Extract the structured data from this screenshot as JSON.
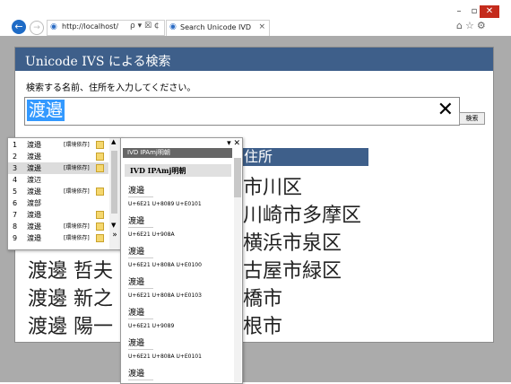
{
  "browser": {
    "url": "http://localhost/",
    "tab_title": "Search Unicode IVD",
    "search_tools": "ρ ▾ ☒ ¢",
    "win_min": "–",
    "win_max": "▫",
    "win_close": "✕",
    "back": "←",
    "forward": "→",
    "tab_close": "×",
    "icons": "⌂☆⚙"
  },
  "page": {
    "heading": "Unicode IVS による検索",
    "prompt": "検索する名前、住所を入力してください。",
    "search_value": "渡邉",
    "clear": "✕",
    "search_button": "検索",
    "address_column": "住所",
    "results": [
      {
        "name": "",
        "address": "市川区"
      },
      {
        "name": "",
        "address": "川崎市多摩区"
      },
      {
        "name": "",
        "address": "横浜市泉区"
      },
      {
        "name": "渡邊 哲夫",
        "address": "古屋市緑区"
      },
      {
        "name": "渡邊 新之",
        "address": "橋市"
      },
      {
        "name": "渡邊 陽一",
        "address": "根市"
      }
    ]
  },
  "candidates": {
    "items": [
      {
        "num": "1",
        "word": "渡邉",
        "tag": "[環境依存]"
      },
      {
        "num": "2",
        "word": "渡邊",
        "tag": ""
      },
      {
        "num": "3",
        "word": "渡邊",
        "tag": "[環境依存]"
      },
      {
        "num": "4",
        "word": "渡辺",
        "tag": ""
      },
      {
        "num": "5",
        "word": "渡邊",
        "tag": "[環境依存]"
      },
      {
        "num": "6",
        "word": "渡部",
        "tag": ""
      },
      {
        "num": "7",
        "word": "渡邉",
        "tag": ""
      },
      {
        "num": "8",
        "word": "渡邊",
        "tag": "[環境依存]"
      },
      {
        "num": "9",
        "word": "渡邉",
        "tag": "[環境依存]"
      }
    ],
    "scroll_up": "▲",
    "scroll_down": "▼",
    "expand": "»"
  },
  "ivd": {
    "title": "IVD IPAmj明朝",
    "controls": "▾ ✕",
    "font_label": "IVD IPAmj明朝",
    "entries": [
      {
        "glyph": "渡邉",
        "code": "U+6E21  U+8089 U+E0101"
      },
      {
        "glyph": "渡邉",
        "code": "U+6E21  U+908A"
      },
      {
        "glyph": "渡邉",
        "code": "U+6E21  U+808A U+E0100"
      },
      {
        "glyph": "渡邉",
        "code": "U+6E21  U+808A U+E0103"
      },
      {
        "glyph": "渡邉",
        "code": "U+6E21  U+9089"
      },
      {
        "glyph": "渡邉",
        "code": "U+6E21  U+808A U+E0101"
      },
      {
        "glyph": "渡邉",
        "code": ""
      }
    ]
  }
}
